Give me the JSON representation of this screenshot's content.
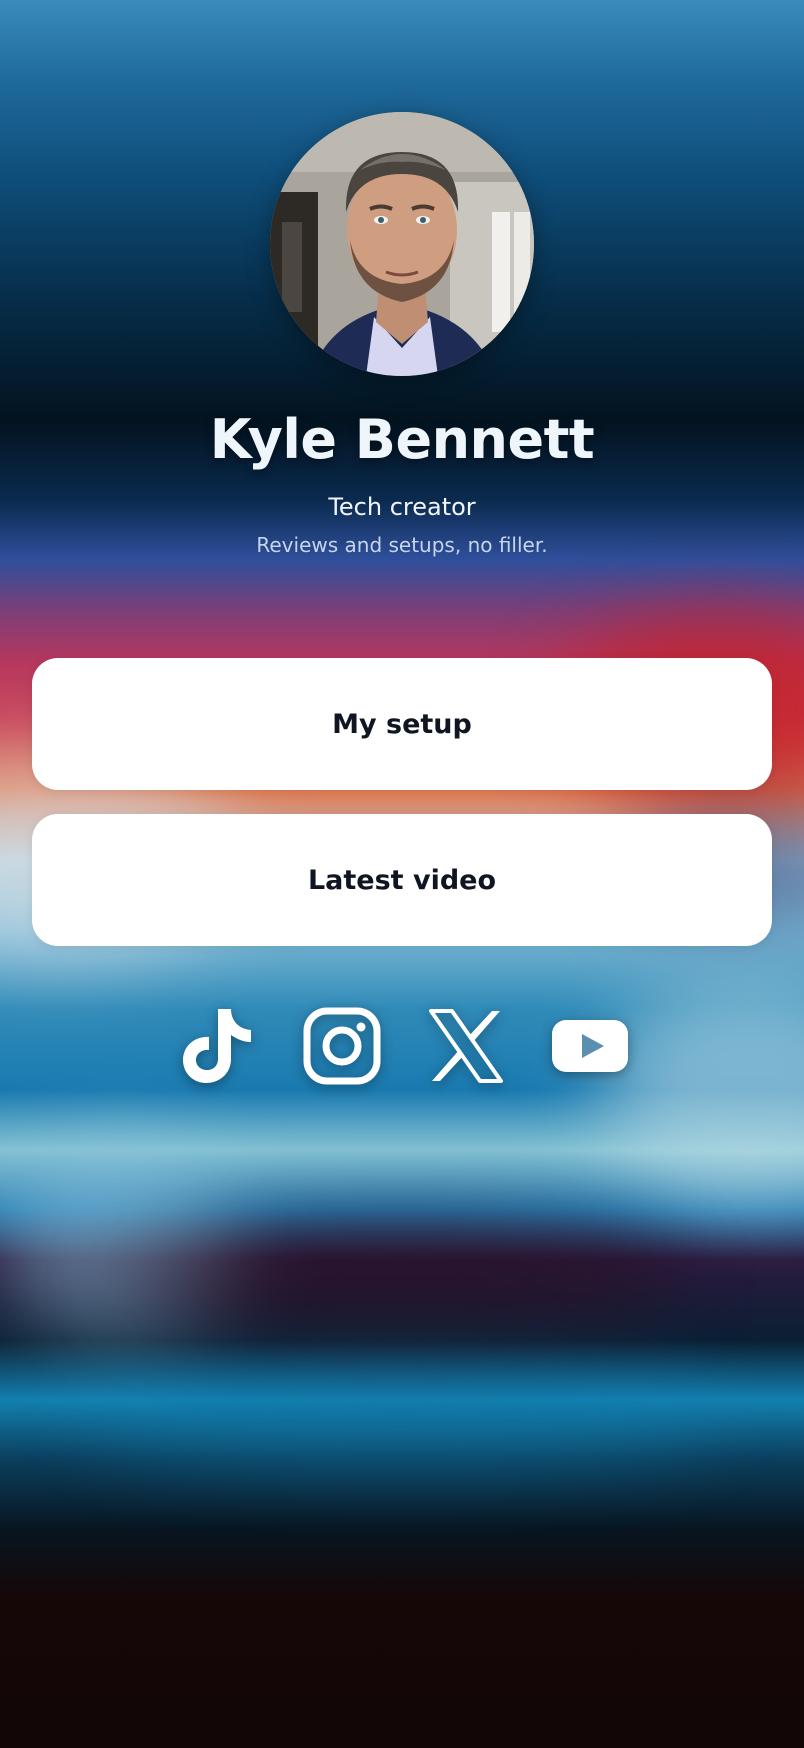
{
  "profile": {
    "name": "Kyle Bennett",
    "role": "Tech creator",
    "bio": "Reviews and setups, no filler."
  },
  "links": [
    {
      "label": "My setup"
    },
    {
      "label": "Latest video"
    }
  ],
  "socials": [
    {
      "icon": "tiktok-icon"
    },
    {
      "icon": "instagram-icon"
    },
    {
      "icon": "x-icon"
    },
    {
      "icon": "youtube-icon"
    }
  ],
  "colors": {
    "button_bg": "#ffffff",
    "button_text": "#101522",
    "name_text": "#eef6fb",
    "bio_text": "#c8d4ea"
  }
}
